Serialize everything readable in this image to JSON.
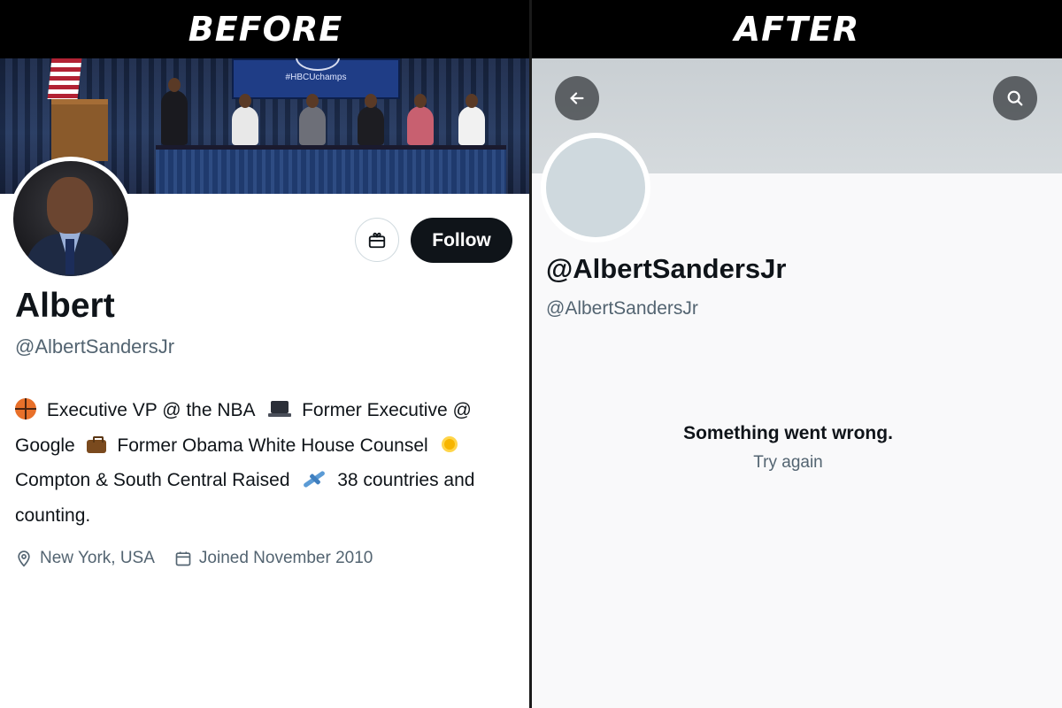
{
  "labels": {
    "before": "BEFORE",
    "after": "AFTER"
  },
  "before": {
    "banner_screen_text": "#HBCUchamps",
    "display_name": "Albert",
    "handle": "@AlbertSandersJr",
    "follow_label": "Follow",
    "bio": [
      {
        "emoji": "basketball-emoji",
        "text": "Executive VP @ the NBA"
      },
      {
        "emoji": "laptop-emoji",
        "text": "Former Executive @ Google"
      },
      {
        "emoji": "briefcase-emoji",
        "text": "Former Obama White House Counsel"
      },
      {
        "emoji": "sun-emoji",
        "text": "Compton & South Central Raised"
      },
      {
        "emoji": "airplane-emoji",
        "text": "38 countries and counting."
      }
    ],
    "location": "New York, USA",
    "joined": "Joined November 2010"
  },
  "after": {
    "handle_title": "@AlbertSandersJr",
    "handle": "@AlbertSandersJr",
    "error_message": "Something went wrong.",
    "retry_label": "Try again"
  },
  "colors": {
    "text_primary": "#0f1419",
    "text_secondary": "#536471",
    "follow_bg": "#0f1419",
    "avatar_placeholder": "#cfd9de"
  }
}
